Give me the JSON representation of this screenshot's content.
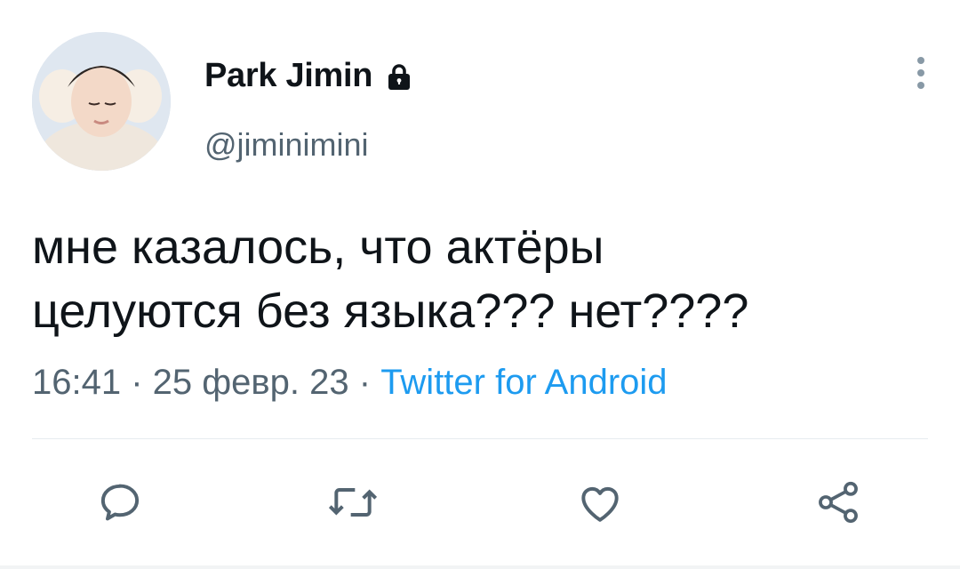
{
  "author": {
    "display_name": "Park Jimin",
    "handle": "@jiminimini",
    "protected": true,
    "avatar_icon": "user-photo-avatar"
  },
  "tweet": {
    "text": "мне казалось, что актёры\nцелуются без языка??? нет????",
    "time": "16:41",
    "date": "25 февр. 23",
    "separator": " · ",
    "source": "Twitter for Android"
  },
  "actions": [
    {
      "name": "reply",
      "icon": "reply-icon"
    },
    {
      "name": "retweet",
      "icon": "retweet-icon"
    },
    {
      "name": "like",
      "icon": "heart-icon"
    },
    {
      "name": "share",
      "icon": "share-icon"
    }
  ],
  "colors": {
    "text": "#0f1419",
    "secondary": "#536471",
    "accent": "#1d9bf0",
    "divider": "#e6ecf0"
  }
}
